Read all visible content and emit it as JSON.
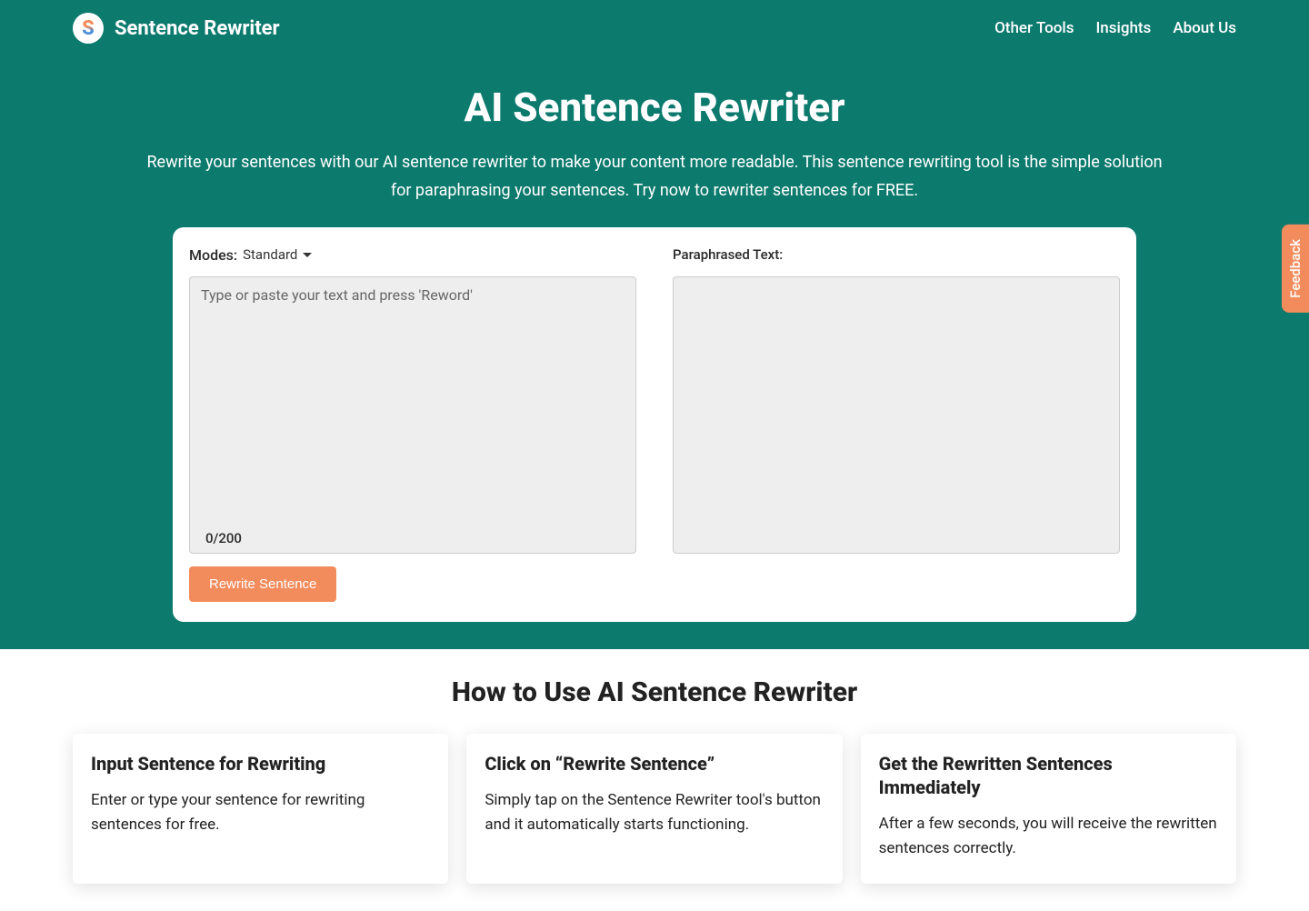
{
  "brand": {
    "logo_letter": "S",
    "name": "Sentence Rewriter"
  },
  "nav": {
    "links": [
      {
        "label": "Other Tools"
      },
      {
        "label": "Insights"
      },
      {
        "label": "About Us"
      }
    ]
  },
  "hero": {
    "title": "AI Sentence Rewriter",
    "subtitle": "Rewrite your sentences with our AI sentence rewriter to make your content more readable. This sentence rewriting tool is the simple solution for paraphrasing your sentences. Try now to rewriter sentences for FREE."
  },
  "tool": {
    "modes_label": "Modes:",
    "selected_mode": "Standard",
    "input_placeholder": "Type or paste your text and press 'Reword'",
    "char_counter": "0/200",
    "rewrite_button": "Rewrite Sentence",
    "output_label": "Paraphrased Text:"
  },
  "howto": {
    "title": "How to Use AI Sentence Rewriter",
    "cards": [
      {
        "title": "Input Sentence for Rewriting",
        "body": "Enter or type your sentence for rewriting sentences for free."
      },
      {
        "title": "Click on “Rewrite Sentence”",
        "body": "Simply tap on the Sentence Rewriter tool's button and it automatically starts functioning."
      },
      {
        "title": "Get the Rewritten Sentences Immediately",
        "body": "After a few seconds, you will receive the rewritten sentences correctly."
      }
    ]
  },
  "feedback": {
    "label": "Feedback"
  }
}
